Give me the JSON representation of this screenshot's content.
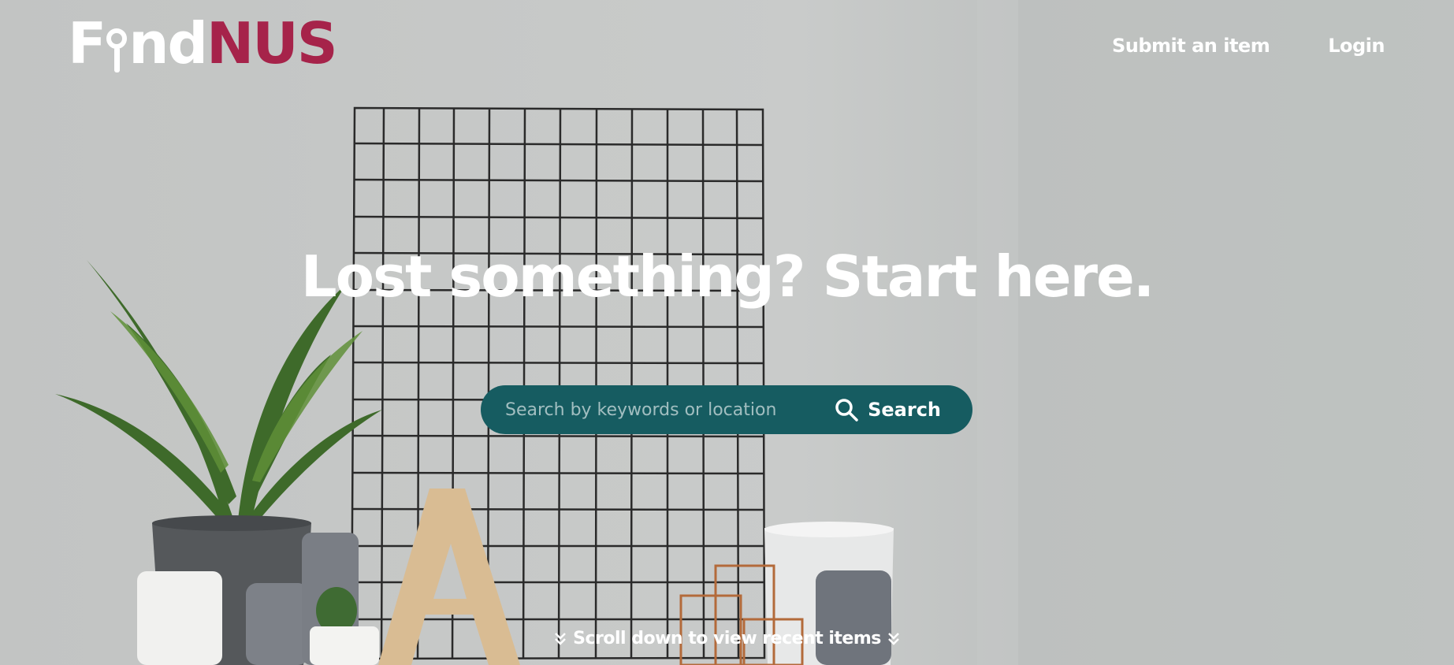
{
  "brand": {
    "logo_part1": "F",
    "logo_part2": "nd",
    "logo_part3": "NUS",
    "accent_color": "#a6234a"
  },
  "nav": {
    "submit_label": "Submit an item",
    "login_label": "Login"
  },
  "hero": {
    "headline": "Lost something? Start here."
  },
  "search": {
    "placeholder": "Search by keywords or location",
    "button_label": "Search",
    "bar_color": "#165c61",
    "icon": "search-icon"
  },
  "scroll": {
    "label": "Scroll down to view recent items",
    "icon": "double-chevron-down-icon"
  }
}
